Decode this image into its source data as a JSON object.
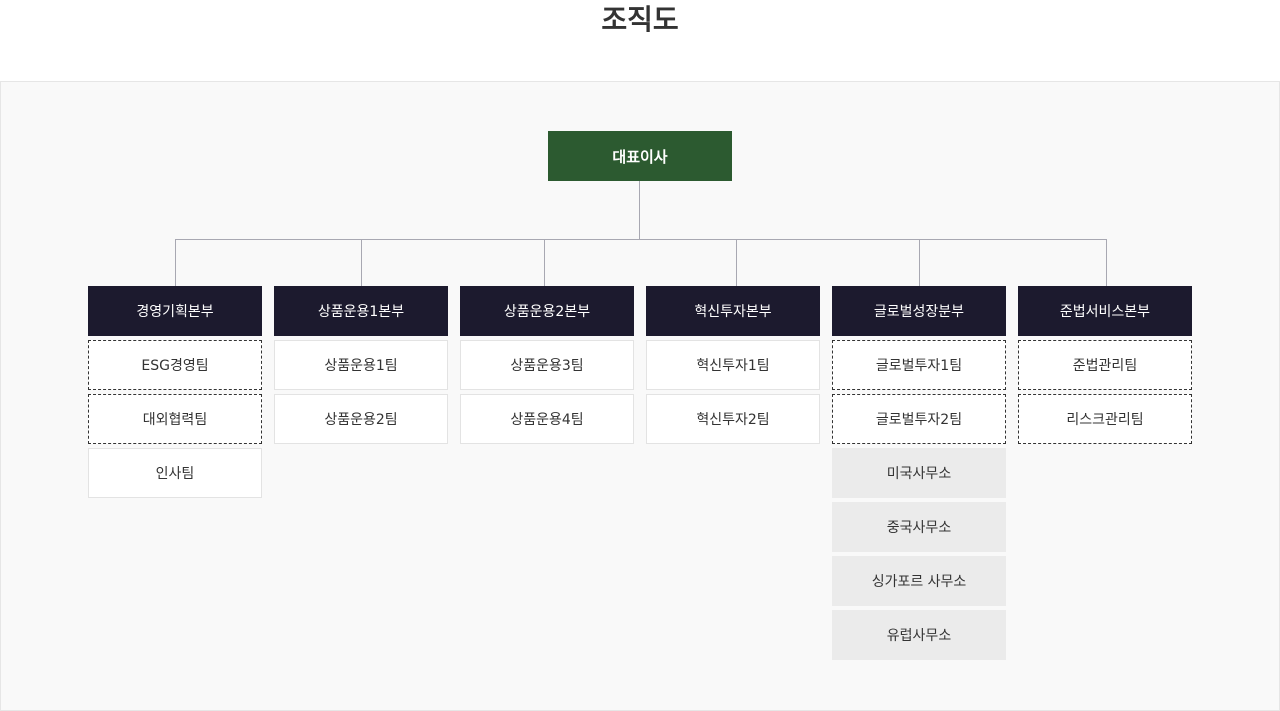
{
  "title": "조직도",
  "ceo": "대표이사",
  "divisions": [
    {
      "name": "경영기획본부",
      "teams": [
        "ESG경영팀",
        "대외협력팀",
        "인사팀"
      ]
    },
    {
      "name": "상품운용1본부",
      "teams": [
        "상품운용1팀",
        "상품운용2팀"
      ]
    },
    {
      "name": "상품운용2본부",
      "teams": [
        "상품운용3팀",
        "상품운용4팀"
      ]
    },
    {
      "name": "혁신투자본부",
      "teams": [
        "혁신투자1팀",
        "혁신투자2팀"
      ]
    },
    {
      "name": "글로벌성장분부",
      "teams": [
        "글로벌투자1팀",
        "글로벌투자2팀",
        "미국사무소",
        "중국사무소",
        "싱가포르 사무소",
        "유럽사무소"
      ]
    },
    {
      "name": "준법서비스본부",
      "teams": [
        "준법관리팀",
        "리스크관리팀"
      ]
    }
  ]
}
